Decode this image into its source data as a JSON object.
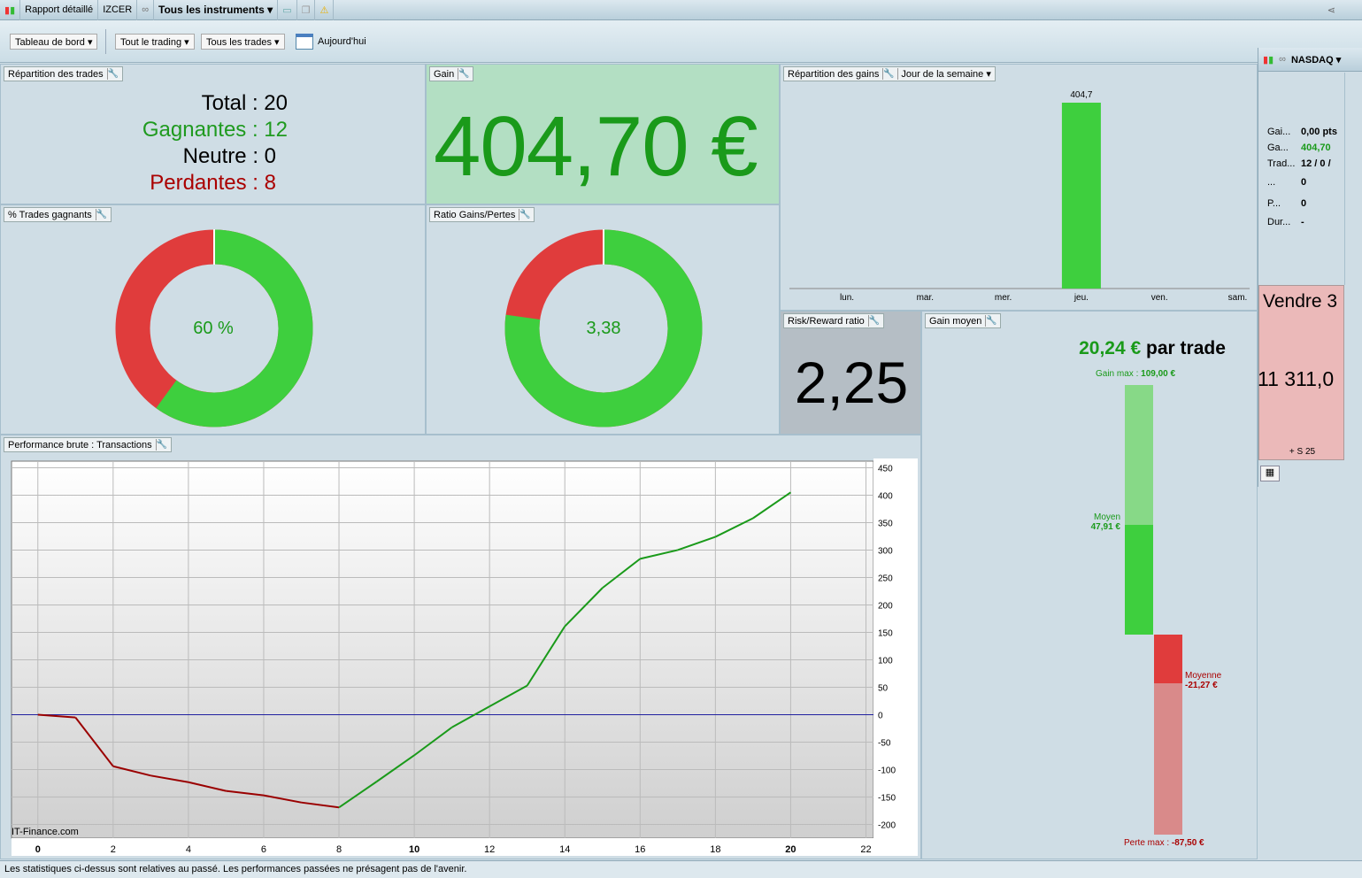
{
  "topbar": {
    "report": "Rapport détaillé",
    "account": "IZCER",
    "instruments": "Tous les instruments"
  },
  "toolbar": {
    "dashboard": "Tableau de bord",
    "trading": "Tout le trading",
    "trades": "Tous les trades",
    "date": "Aujourd'hui"
  },
  "trades_split": {
    "title": "Répartition des trades",
    "total_label": "Total : 20",
    "win_label": "Gagnantes : 12",
    "neutral_label": "Neutre : 0",
    "lose_label": "Perdantes : 8"
  },
  "gain": {
    "title": "Gain",
    "value": "404,70 €"
  },
  "pct_win": {
    "title": "% Trades gagnants",
    "label": "60 %",
    "value": 0.6
  },
  "ratio": {
    "title": "Ratio Gains/Pertes",
    "label": "3,38",
    "value": 3.38
  },
  "gains_dist": {
    "title": "Répartition des gains",
    "selector": "Jour de la semaine",
    "days": [
      "lun.",
      "mar.",
      "mer.",
      "jeu.",
      "ven.",
      "sam."
    ],
    "values": [
      0,
      0,
      0,
      404.7,
      0,
      0
    ],
    "bar_label": "404,7"
  },
  "risk_reward": {
    "title": "Risk/Reward ratio",
    "value": "2,25"
  },
  "avg_gain": {
    "title": "Gain moyen",
    "headline_value": "20,24 €",
    "headline_suffix": " par trade",
    "max_label": "Gain max : ",
    "max_value": "109,00 €",
    "avg_win_label": "Moyen",
    "avg_win_value": "47,91 €",
    "avg_loss_label": "Moyenne",
    "avg_loss_value": "-21,27 €",
    "min_label": "Perte max : ",
    "min_value": "-87,50 €",
    "max": 109,
    "avg_win": 47.91,
    "avg_loss": -21.27,
    "min": -87.5
  },
  "chart_data": {
    "type": "line",
    "title": "Performance brute : Transactions",
    "x": [
      0,
      1,
      2,
      3,
      4,
      5,
      6,
      7,
      8,
      9,
      10,
      11,
      12,
      13,
      14,
      15,
      16,
      17,
      18,
      19,
      20
    ],
    "y": [
      0,
      -5,
      -94,
      -111,
      -123,
      -139,
      -147,
      -160,
      -169,
      -122,
      -74,
      -23,
      15,
      53,
      161,
      231,
      284,
      300,
      324,
      358,
      405
    ],
    "xlim": [
      -0.7,
      22.2
    ],
    "ylim": [
      -225,
      462
    ],
    "xticks": [
      0,
      2,
      4,
      6,
      8,
      10,
      12,
      14,
      16,
      18,
      20,
      22
    ],
    "yticks": [
      450,
      400,
      350,
      300,
      250,
      200,
      150,
      100,
      50,
      0,
      -50,
      -100,
      -150,
      -200
    ],
    "watermark": "IT-Finance.com",
    "colors": {
      "negative": "#9a0000",
      "positive": "#1a9a1a",
      "zero": "#2020a0"
    }
  },
  "right_panel": {
    "instrument": "NASDAQ",
    "rows": [
      [
        "Gai...",
        "0,00 pts"
      ],
      [
        "Ga...",
        "404,70"
      ],
      [
        "Trad...",
        "12 / 0 /"
      ],
      [
        "...",
        "0"
      ],
      [
        "P...",
        "0"
      ],
      [
        "Dur...",
        "-"
      ]
    ],
    "order": "Vendre 3",
    "price": "11 311,0",
    "sub": "+ S 25"
  },
  "footer": {
    "disclaimer": "Les statistiques ci-dessus sont relatives au passé. Les performances passées ne présagent pas de l'avenir."
  }
}
